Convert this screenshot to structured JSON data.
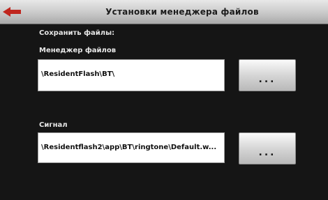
{
  "header": {
    "title": "Установки менеджера файлов",
    "back_icon": "arrow-left-icon",
    "back_icon_color": "#c0261e"
  },
  "save_files_label": "Сохранить файлы:",
  "file_manager": {
    "label": "Менеджер файлов",
    "path": "\\ResidentFlash\\BT\\",
    "browse_label": "..."
  },
  "signal": {
    "label": "Сигнал",
    "path": "\\Residentflash2\\app\\BT\\ringtone\\Default.w...",
    "browse_label": "..."
  }
}
